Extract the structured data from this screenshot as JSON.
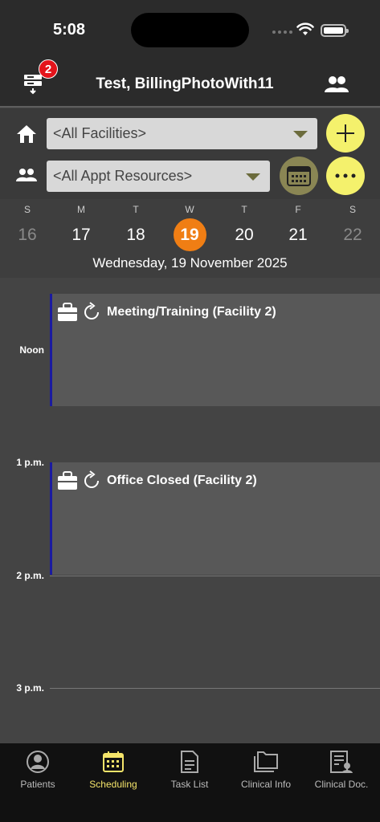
{
  "status": {
    "time": "5:08"
  },
  "header": {
    "badge_count": "2",
    "title": "Test, BillingPhotoWith11"
  },
  "filters": {
    "facility_selected": "<All Facilities>",
    "resource_selected": "<All Appt Resources>"
  },
  "week": {
    "days": [
      {
        "letter": "S",
        "num": "16"
      },
      {
        "letter": "M",
        "num": "17"
      },
      {
        "letter": "T",
        "num": "18"
      },
      {
        "letter": "W",
        "num": "19"
      },
      {
        "letter": "T",
        "num": "20"
      },
      {
        "letter": "F",
        "num": "21"
      },
      {
        "letter": "S",
        "num": "22"
      }
    ],
    "selected_label": "Wednesday, 19 November 2025"
  },
  "timeline": {
    "hours": [
      "Noon",
      "1 p.m.",
      "2 p.m.",
      "3 p.m."
    ],
    "appointments": [
      {
        "title": "Meeting/Training (Facility 2)"
      },
      {
        "title": "Office Closed (Facility 2)"
      }
    ]
  },
  "tabs": [
    {
      "label": "Patients"
    },
    {
      "label": "Scheduling"
    },
    {
      "label": "Task List"
    },
    {
      "label": "Clinical Info"
    },
    {
      "label": "Clinical Doc."
    }
  ],
  "colors": {
    "accent": "#f4f16c",
    "selected_day": "#f07e14",
    "badge": "#e4141b",
    "active_tab": "#f4e46a"
  }
}
